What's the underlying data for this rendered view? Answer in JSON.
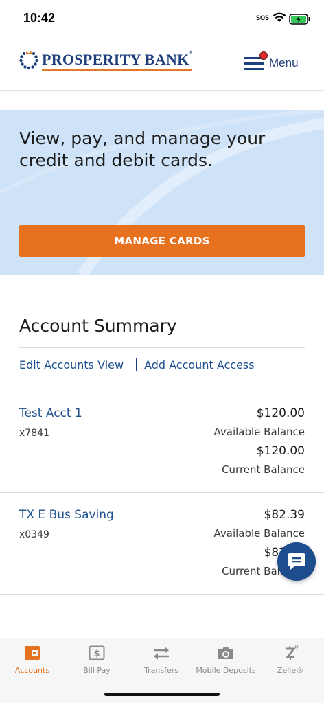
{
  "status": {
    "time": "10:42",
    "sos": "SOS"
  },
  "header": {
    "brand": "PROSPERITY BANK",
    "brand_mark": "®",
    "menu_label": "Menu"
  },
  "banner": {
    "headline": "View, pay, and manage your credit and debit cards.",
    "button_label": "MANAGE CARDS",
    "button_color": "#e6711e",
    "background": "#cfe3f8"
  },
  "summary": {
    "title": "Account Summary",
    "edit_link": "Edit Accounts View",
    "add_link": "Add Account Access"
  },
  "accounts": [
    {
      "name": "Test Acct 1",
      "number": "x7841",
      "available_amount": "$120.00",
      "available_label": "Available Balance",
      "current_amount": "$120.00",
      "current_label": "Current Balance"
    },
    {
      "name": "TX E Bus Saving",
      "number": "x0349",
      "available_amount": "$82.39",
      "available_label": "Available Balance",
      "current_amount": "$82.39",
      "current_label": "Current Balance"
    }
  ],
  "tabs": [
    {
      "label": "Accounts",
      "icon": "wallet-icon",
      "active": true
    },
    {
      "label": "Bill Pay",
      "icon": "bill-icon",
      "active": false
    },
    {
      "label": "Transfers",
      "icon": "transfer-arrows-icon",
      "active": false
    },
    {
      "label": "Mobile Deposits",
      "icon": "camera-icon",
      "active": false
    },
    {
      "label": "Zelle®",
      "icon": "zelle-icon",
      "active": false
    }
  ],
  "colors": {
    "brand_navy": "#1d3f7e",
    "accent_orange": "#e6711e",
    "link_blue": "#1d4f8f"
  }
}
